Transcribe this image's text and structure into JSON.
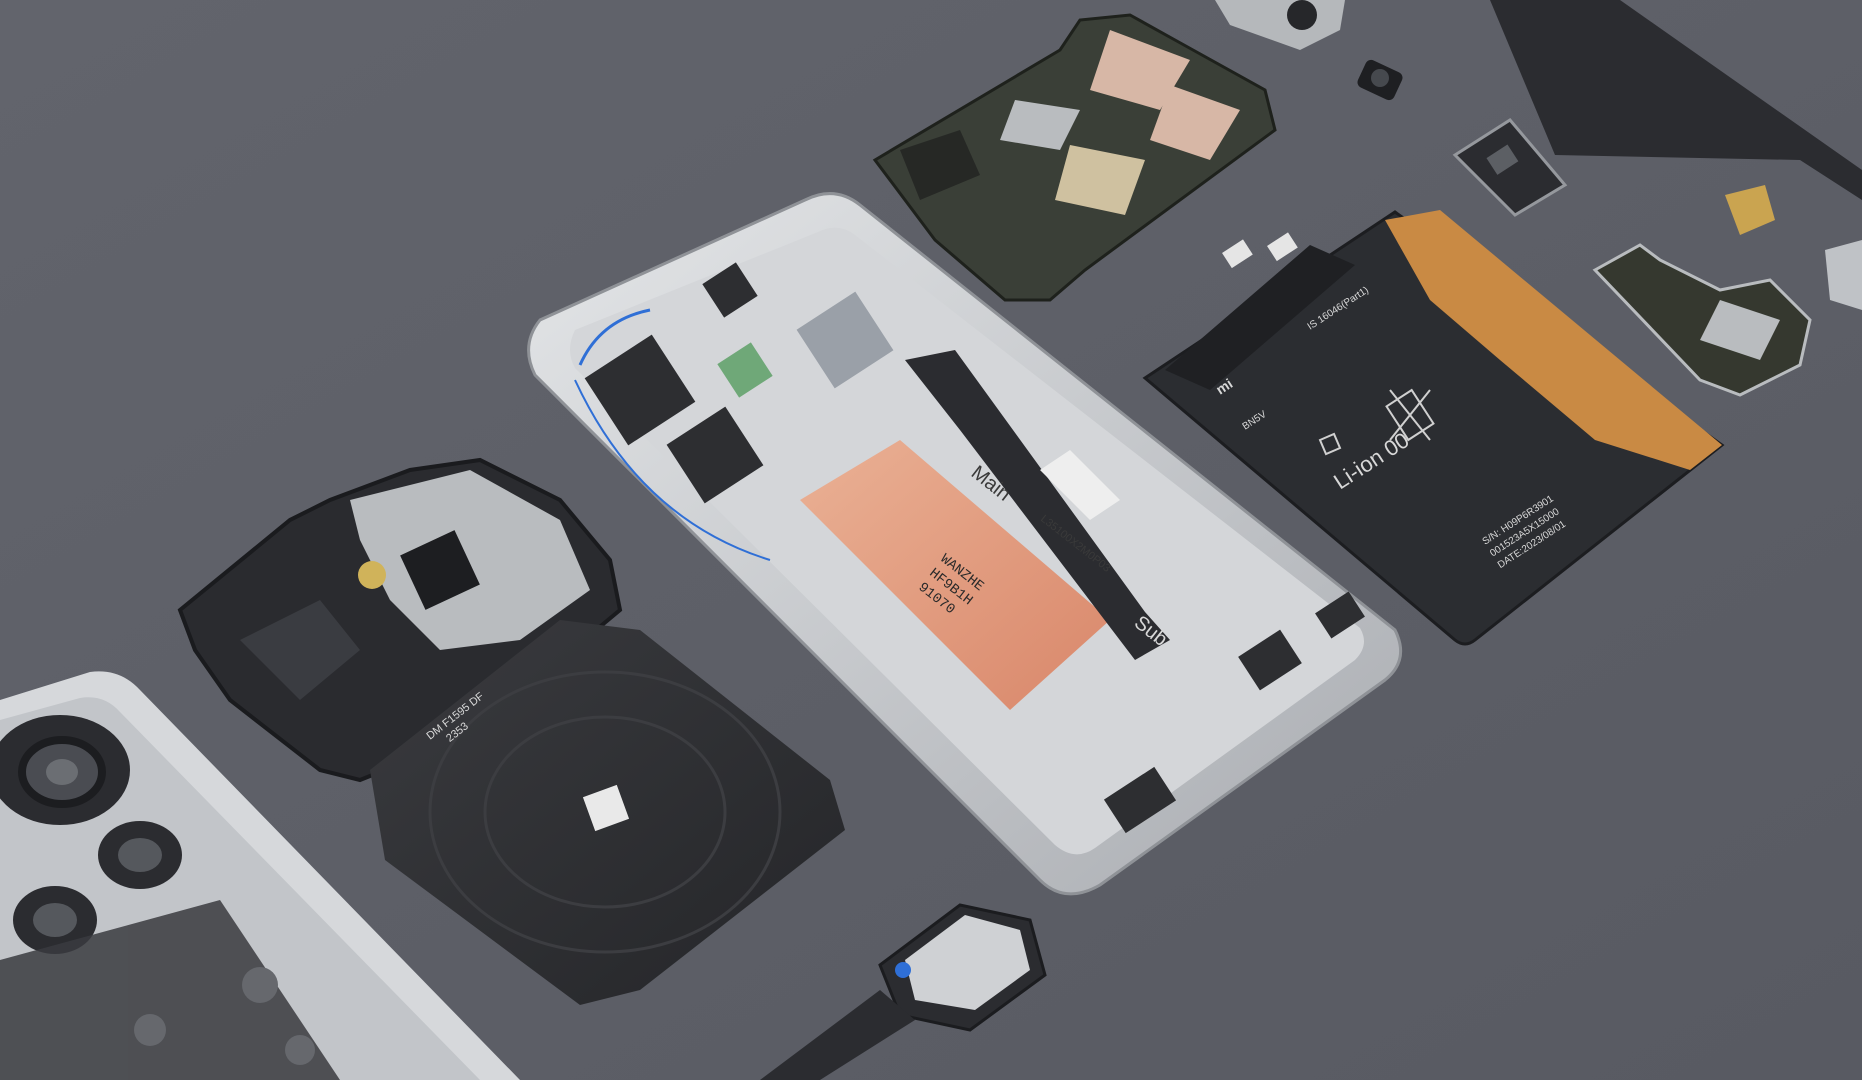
{
  "scene": {
    "colors": {
      "background": "#5e6068",
      "frame_silver": "#c9ccd1",
      "frame_inner": "#d9dbde",
      "graphite_sheet": "#e08a5e",
      "battery_body": "#2b2d31",
      "battery_tape": "#c98a44",
      "board_green": "#3a3f37",
      "shield_silver": "#b9bcbf",
      "coil_black": "#2f3033"
    },
    "labels": {
      "main_flex": "Main",
      "sub_flex": "Sub",
      "battery_chem": "Li-ion 00",
      "battery_logo": "mi",
      "coil_code": "DM F1595 DF",
      "coil_year": "2353",
      "graphite_text_1": "WANZHE",
      "graphite_text_2": "HF9B1H",
      "graphite_text_3": "91070",
      "flex_code": "L35100X2M0P03",
      "battery_id": "IS 16046(Part1)",
      "battery_sn": "S/N: H09P6R3901",
      "battery_date": "DATE:2023/08/01",
      "battery_lot": "001523A5X15000",
      "battery_bn": "BN5V"
    },
    "icons": [
      "recycle-icon",
      "crossed-bin-icon",
      "qr-code-icon",
      "camera-lens-icon",
      "speaker-icon",
      "sim-tray-icon"
    ]
  }
}
